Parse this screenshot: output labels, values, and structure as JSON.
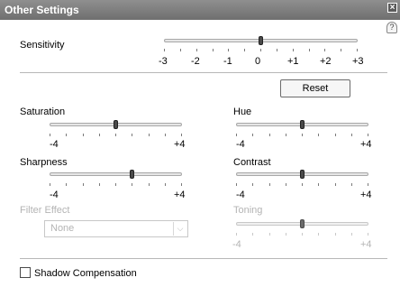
{
  "window": {
    "title": "Other Settings",
    "close_glyph": "×",
    "help_glyph": "?"
  },
  "sensitivity": {
    "label": "Sensitivity",
    "ticks": [
      "-3",
      "-2",
      "-1",
      "0",
      "+1",
      "+2",
      "+3"
    ],
    "value": 0
  },
  "reset": {
    "label": "Reset"
  },
  "saturation": {
    "label": "Saturation",
    "min_label": "-4",
    "max_label": "+4",
    "value": 0
  },
  "hue": {
    "label": "Hue",
    "min_label": "-4",
    "max_label": "+4",
    "value": 0
  },
  "sharpness": {
    "label": "Sharpness",
    "min_label": "-4",
    "max_label": "+4",
    "value": 1
  },
  "contrast": {
    "label": "Contrast",
    "min_label": "-4",
    "max_label": "+4",
    "value": 0
  },
  "filter_effect": {
    "label": "Filter Effect",
    "selected": "None",
    "enabled": false
  },
  "toning": {
    "label": "Toning",
    "min_label": "-4",
    "max_label": "+4",
    "value": 0,
    "enabled": false
  },
  "shadow_compensation": {
    "label": "Shadow Compensation",
    "checked": false
  },
  "icons": {
    "close": "close-icon",
    "help": "help-icon",
    "dropdown": "chevron-down-icon"
  },
  "colors": {
    "titlebar": "#7f7f7f",
    "disabled_text": "#b4b4b4"
  }
}
